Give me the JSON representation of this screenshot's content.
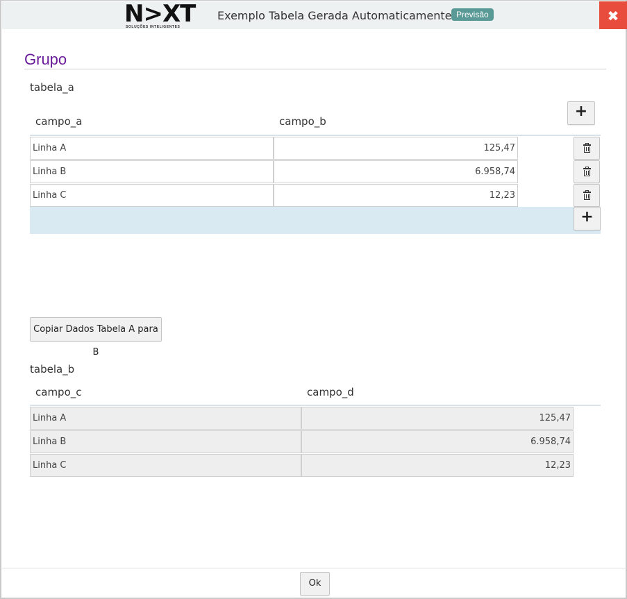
{
  "window": {
    "logo_text": "N>XT",
    "logo_subtitle": "SOLUÇÕES INTELIGENTES",
    "title": "Exemplo Tabela Gerada Automaticamente",
    "badge": "Previsão",
    "close_icon": "close-icon"
  },
  "group": {
    "title": "Grupo"
  },
  "tabela_a": {
    "label": "tabela_a",
    "columns": [
      "campo_a",
      "campo_b"
    ],
    "rows": [
      {
        "campo_a": "Linha A",
        "campo_b": "125,47"
      },
      {
        "campo_a": "Linha B",
        "campo_b": "6.958,74"
      },
      {
        "campo_a": "Linha C",
        "campo_b": "12,23"
      }
    ],
    "add_label": "+",
    "row_add_label": "+",
    "highlight_color": "#d9eaf3"
  },
  "copy_button": {
    "label": "Copiar Dados Tabela A para B"
  },
  "tabela_b": {
    "label": "tabela_b",
    "columns": [
      "campo_c",
      "campo_d"
    ],
    "rows": [
      {
        "campo_c": "Linha A",
        "campo_d": "125,47"
      },
      {
        "campo_c": "Linha B",
        "campo_d": "6.958,74"
      },
      {
        "campo_c": "Linha C",
        "campo_d": "12,23"
      }
    ]
  },
  "footer": {
    "ok_label": "Ok"
  },
  "colors": {
    "accent": "#6a1b9a",
    "close": "#e74c3c",
    "badge": "#5a9a96"
  }
}
